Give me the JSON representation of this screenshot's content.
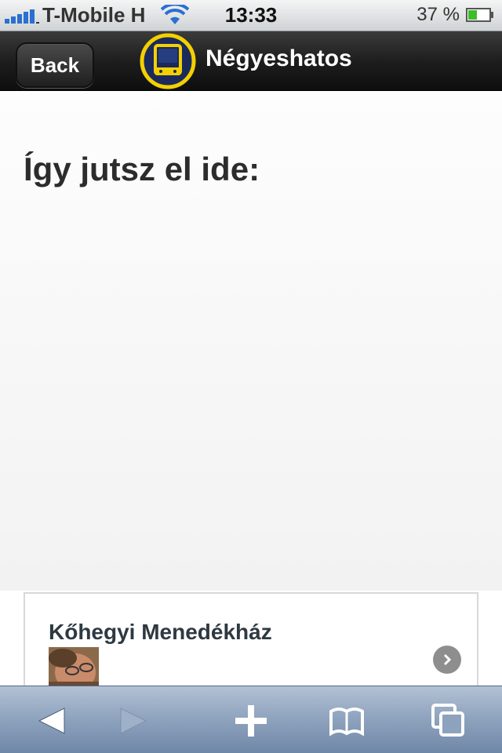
{
  "status_bar": {
    "carrier": "T-Mobile H",
    "time": "13:33",
    "battery": "37 %",
    "signal_icon": "signal-bars-icon",
    "wifi_icon": "wifi-icon",
    "battery_icon": "battery-icon"
  },
  "nav": {
    "back_label": "Back",
    "title": "Négyeshatos",
    "logo_icon": "tram-logo-icon"
  },
  "page": {
    "heading": "Így jutsz el ide:"
  },
  "list": {
    "items": [
      {
        "title": "Kőhegyi Menedékház",
        "avatar": "avatar",
        "chevron_icon": "chevron-right-icon"
      }
    ]
  },
  "toolbar": {
    "icons": [
      "back-arrow-icon",
      "forward-arrow-icon",
      "add-plus-icon",
      "bookmarks-book-icon",
      "pages-tabs-icon"
    ]
  },
  "colors": {
    "navbar": "#1e1e1e",
    "logo_ring": "#f3d000",
    "logo_fill": "#1b2a5a",
    "toolbar": "#8da2bd",
    "heading": "#2c2c2c"
  }
}
